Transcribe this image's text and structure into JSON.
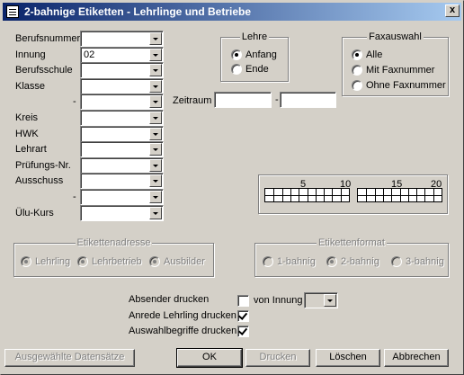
{
  "window": {
    "title": "2-bahnige Etiketten - Lehrlinge und Betriebe",
    "close_glyph": "x"
  },
  "fields": [
    {
      "label": "Berufsnummer",
      "value": ""
    },
    {
      "label": "Innung",
      "value": "02"
    },
    {
      "label": "Berufsschule",
      "value": ""
    },
    {
      "label": "Klasse",
      "value": ""
    },
    {
      "label": "-",
      "value": ""
    },
    {
      "label": "Kreis",
      "value": ""
    },
    {
      "label": "HWK",
      "value": ""
    },
    {
      "label": "Lehrart",
      "value": ""
    },
    {
      "label": "Prüfungs-Nr.",
      "value": ""
    },
    {
      "label": "Ausschuss",
      "value": ""
    },
    {
      "label": "-",
      "value": ""
    },
    {
      "label": "Ülu-Kurs",
      "value": ""
    }
  ],
  "lehre": {
    "title": "Lehre",
    "options": [
      {
        "label": "Anfang",
        "selected": true
      },
      {
        "label": "Ende",
        "selected": false
      }
    ]
  },
  "faxauswahl": {
    "title": "Faxauswahl",
    "options": [
      {
        "label": "Alle",
        "selected": true
      },
      {
        "label": "Mit Faxnummer",
        "selected": false
      },
      {
        "label": "Ohne Faxnummer",
        "selected": false
      }
    ]
  },
  "zeitraum": {
    "label": "Zeitraum",
    "separator": "-",
    "from": "",
    "to": ""
  },
  "label_grid": {
    "left_ticks": [
      "5",
      "10"
    ],
    "right_ticks": [
      "15",
      "20"
    ]
  },
  "etikettenadresse": {
    "title": "Etikettenadresse",
    "options": [
      {
        "label": "Lehrling",
        "selected": true
      },
      {
        "label": "Lehrbetrieb",
        "selected": true
      },
      {
        "label": "Ausbilder",
        "selected": true
      }
    ]
  },
  "etikettenformat": {
    "title": "Etikettenformat",
    "options": [
      {
        "label": "1-bahnig",
        "selected": false
      },
      {
        "label": "2-bahnig",
        "selected": true
      },
      {
        "label": "3-bahnig",
        "selected": false
      }
    ]
  },
  "checks": {
    "absender": {
      "label": "Absender drucken"
    },
    "von_innung": {
      "label": "von Innung",
      "checked": false
    },
    "anrede": {
      "label": "Anrede Lehrling drucken",
      "checked": true
    },
    "auswahl": {
      "label": "Auswahlbegriffe drucken",
      "checked": true
    }
  },
  "buttons": {
    "ausgewaehlte": "Ausgewählte Datensätze",
    "ok": "OK",
    "drucken": "Drucken",
    "loeschen": "Löschen",
    "abbrechen": "Abbrechen"
  }
}
